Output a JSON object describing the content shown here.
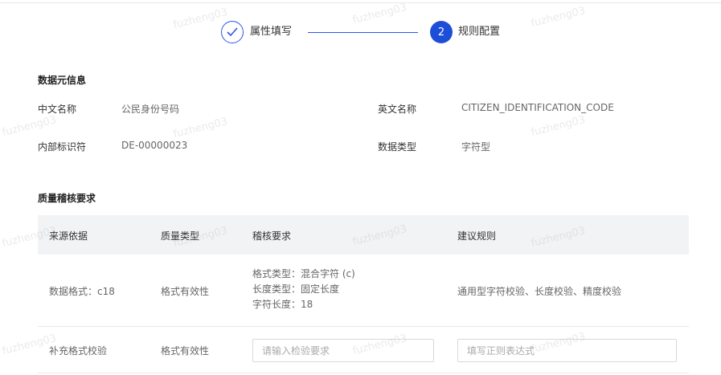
{
  "steps": [
    {
      "label": "属性填写"
    },
    {
      "number": "2",
      "label": "规则配置"
    }
  ],
  "meta": {
    "title": "数据元信息",
    "cn_name_label": "中文名称",
    "cn_name_value": "公民身份号码",
    "en_name_label": "英文名称",
    "en_name_value": "CITIZEN_IDENTIFICATION_CODE",
    "id_label": "内部标识符",
    "id_value": "DE-00000023",
    "type_label": "数据类型",
    "type_value": "字符型"
  },
  "quality": {
    "title": "质量稽核要求",
    "columns": [
      "来源依据",
      "质量类型",
      "稽核要求",
      "建议规则"
    ],
    "row1": {
      "source": "数据格式：c18",
      "qtype": "格式有效性",
      "req_lines": [
        "格式类型：混合字符 (c)",
        "长度类型：固定长度",
        "字符长度：18"
      ],
      "rule": "通用型字符校验、长度校验、精度校验"
    },
    "row2": {
      "source": "补充格式校验",
      "qtype": "格式有效性",
      "req_placeholder": "请输入检验要求",
      "rule_placeholder": "填写正则表达式"
    }
  },
  "watermark": "fuzheng03",
  "colors": {
    "primary": "#1d4ed8",
    "header_bg": "#f2f3f5"
  }
}
